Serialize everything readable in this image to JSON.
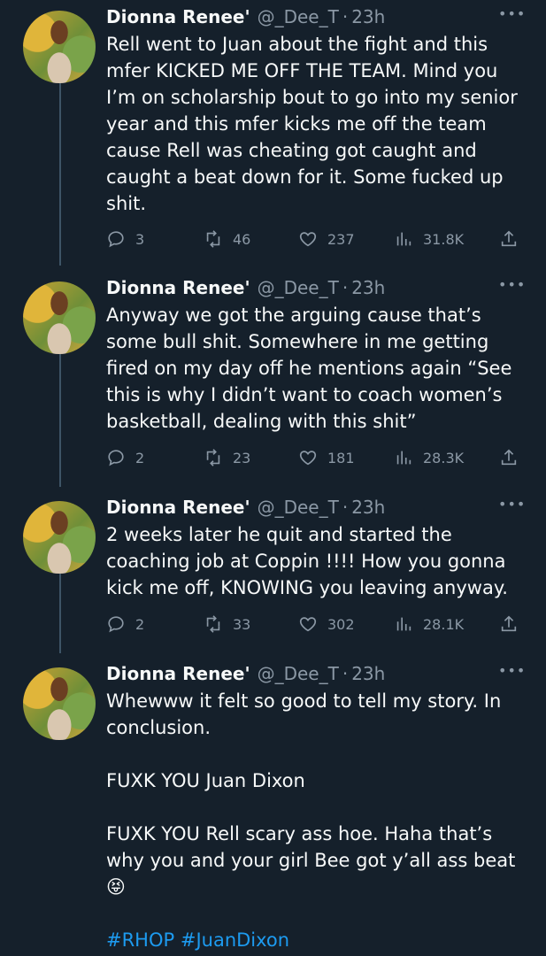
{
  "tweets": [
    {
      "name": "Dionna Renee'",
      "handle": "@_Dee_T",
      "separator": "·",
      "time": "23h",
      "text": "Rell went to Juan about the fight and this\nmfer KICKED ME OFF THE TEAM. Mind you\nI’m on scholarship bout to go into my senior\nyear and this mfer kicks me off the team\ncause Rell was cheating got caught and\ncaught a beat down for it. Some fucked up\nshit.",
      "replies": "3",
      "retweets": "46",
      "likes": "237",
      "views": "31.8K"
    },
    {
      "name": "Dionna Renee'",
      "handle": "@_Dee_T",
      "separator": "·",
      "time": "23h",
      "text": "Anyway we got the arguing cause that’s\nsome bull shit. Somewhere in me getting\nfired on my day off he mentions again “See\nthis is why I didn’t want to coach women’s\nbasketball, dealing with this shit”",
      "replies": "2",
      "retweets": "23",
      "likes": "181",
      "views": "28.3K"
    },
    {
      "name": "Dionna Renee'",
      "handle": "@_Dee_T",
      "separator": "·",
      "time": "23h",
      "text": "2 weeks later he quit and started the\ncoaching job at Coppin !!!! How you gonna\nkick me off, KNOWING you leaving anyway.",
      "replies": "2",
      "retweets": "33",
      "likes": "302",
      "views": "28.1K"
    },
    {
      "name": "Dionna Renee'",
      "handle": "@_Dee_T",
      "separator": "·",
      "time": "23h",
      "text": "Whewww it felt so good to tell my story. In\nconclusion.\n\nFUXK YOU Juan Dixon\n\nFUXK YOU Rell scary ass hoe. Haha that’s\nwhy you and your girl Bee got y’all ass beat\n😝\n\n",
      "hashtags": "#RHOP #JuanDixon"
    }
  ],
  "more_glyph": "•••"
}
